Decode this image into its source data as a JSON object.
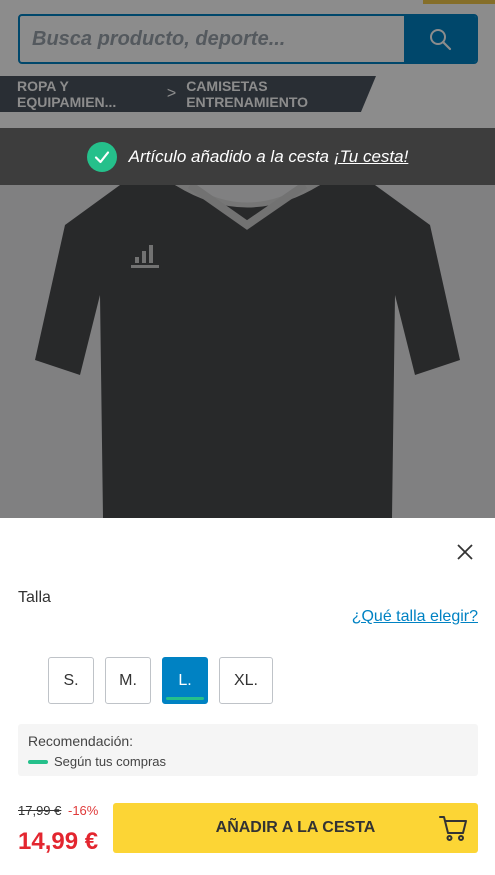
{
  "search": {
    "placeholder": "Busca producto, deporte..."
  },
  "breadcrumb": {
    "items": [
      "ROPA Y EQUIPAMIEN...",
      "CAMISETAS ENTRENAMIENTO"
    ],
    "separator": ">"
  },
  "notification": {
    "message": "Artículo añadido a la cesta",
    "link": "¡Tu cesta!"
  },
  "product": {
    "image": "black-adidas-training-tshirt"
  },
  "size_panel": {
    "label": "Talla",
    "guide_link": "¿Qué talla elegir?",
    "sizes": [
      "S.",
      "M.",
      "L.",
      "XL."
    ],
    "selected": "L."
  },
  "recommendation": {
    "title": "Recomendación:",
    "text": "Según tus compras"
  },
  "price": {
    "old": "17,99 €",
    "discount": "-16%",
    "current": "14,99 €"
  },
  "cta": {
    "label": "AÑADIR A LA CESTA"
  },
  "colors": {
    "primary_blue": "#0082c3",
    "cta_yellow": "#fcd535",
    "success_green": "#25c08b",
    "price_red": "#e3262f"
  }
}
